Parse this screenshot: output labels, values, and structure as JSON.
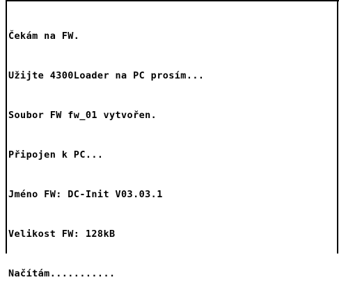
{
  "console": {
    "lines": [
      "Čekám na FW.",
      "Užijte 4300Loader na PC prosím...",
      "Soubor FW fw_01 vytvořen.",
      "Připojen k PC...",
      "Jméno FW: DC-Init V03.03.1",
      "Velikost FW: 128kB",
      "Načítám..........."
    ]
  },
  "colors": {
    "background": "#ffffff",
    "text": "#000000",
    "border": "#000000"
  }
}
